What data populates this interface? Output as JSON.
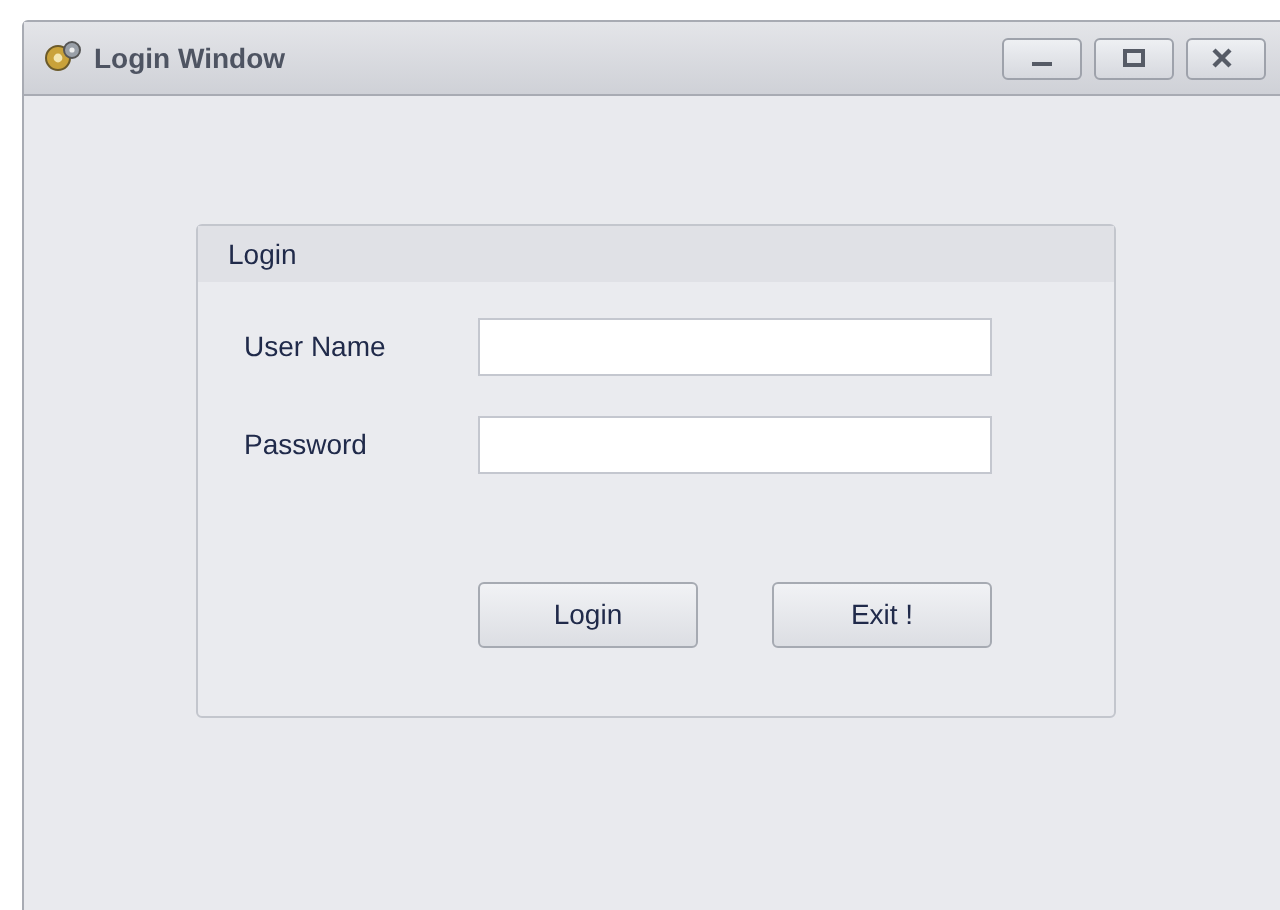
{
  "window": {
    "title": "Login Window"
  },
  "group": {
    "title": "Login",
    "fields": [
      {
        "label": "User Name"
      },
      {
        "label": "Password"
      }
    ],
    "buttons": [
      "Login",
      "Exit !"
    ]
  }
}
